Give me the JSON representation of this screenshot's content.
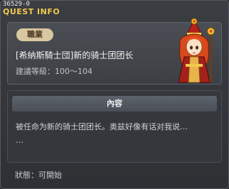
{
  "header": {
    "quest_id": "36529-0",
    "title": "QUEST INFO"
  },
  "quest": {
    "category": "職業",
    "name": "[希納斯騎士団]新的骑士团团长",
    "level_label": "建議等級",
    "level_range": "100～104",
    "npc_icon": "red-haired-mage-npc"
  },
  "content": {
    "heading": "內容",
    "lines": [
      "被任命为新的骑士团团长。奥兹好像有话对我说…",
      "…"
    ]
  },
  "status": {
    "label": "狀態",
    "value": "可開始"
  },
  "colors": {
    "title": "#f2c94c",
    "badge": "#d9c7a0"
  }
}
